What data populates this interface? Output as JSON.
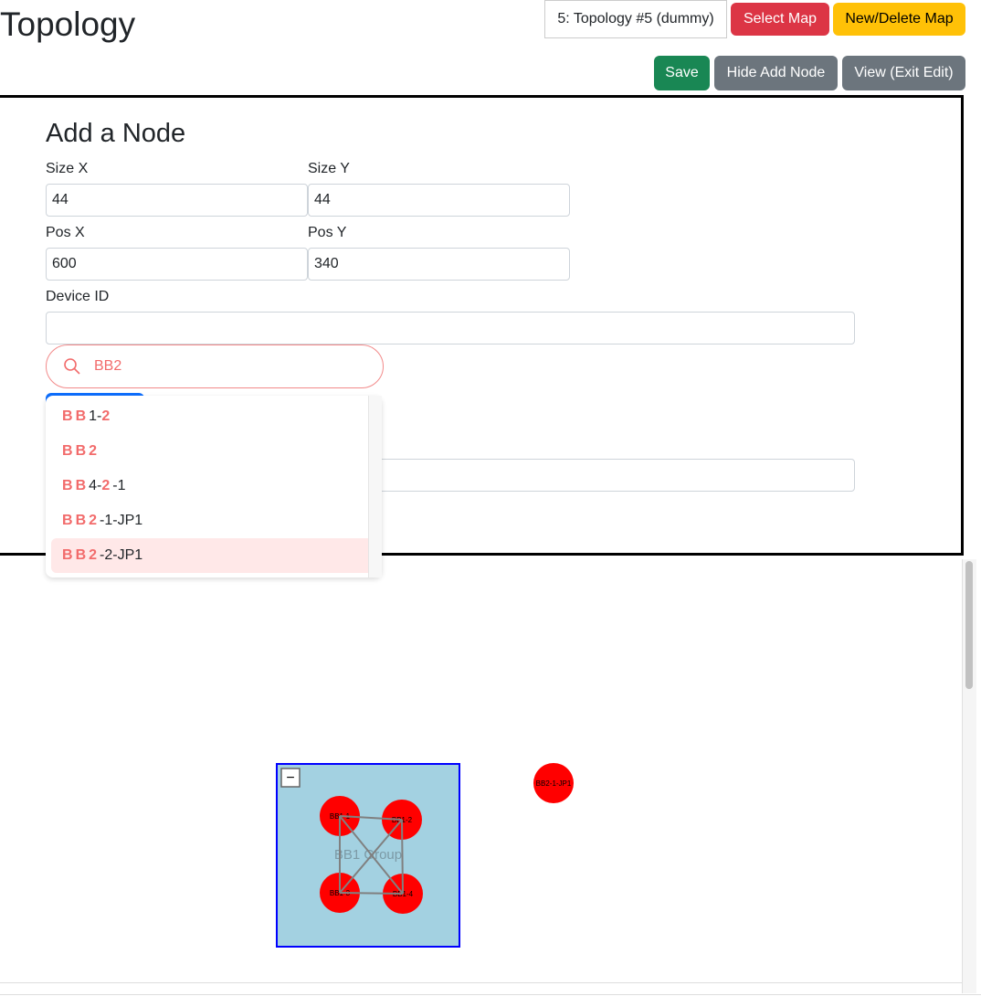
{
  "page_title": "Topology",
  "map_select": "5: Topology #5 (dummy)",
  "buttons": {
    "select_map": "Select Map",
    "new_delete_map": "New/Delete Map",
    "save": "Save",
    "hide_add_node": "Hide Add Node",
    "view_exit_edit": "View (Exit Edit)"
  },
  "colors": {
    "danger": "#dc3545",
    "warning": "#ffc107",
    "success": "#198754",
    "secondary": "#6c757d",
    "highlight": "#f26b6b"
  },
  "add_node": {
    "heading": "Add a Node",
    "size_x_label": "Size X",
    "size_x": "44",
    "size_y_label": "Size Y",
    "size_y": "44",
    "pos_x_label": "Pos X",
    "pos_x": "600",
    "pos_y_label": "Pos Y",
    "pos_y": "340",
    "device_id_label": "Device ID",
    "device_id": "",
    "search_value": "BB2"
  },
  "dropdown": [
    [
      [
        "B",
        1
      ],
      [
        "B",
        1
      ],
      [
        "1-",
        0
      ],
      [
        "2",
        1
      ]
    ],
    [
      [
        "B",
        1
      ],
      [
        "B",
        1
      ],
      [
        "2",
        1
      ]
    ],
    [
      [
        "B",
        1
      ],
      [
        "B",
        1
      ],
      [
        "4-",
        0
      ],
      [
        "2",
        1
      ],
      [
        "-1",
        0
      ]
    ],
    [
      [
        "B",
        1
      ],
      [
        "B",
        1
      ],
      [
        "2",
        1
      ],
      [
        "-1-JP1",
        0
      ]
    ],
    [
      [
        "B",
        1
      ],
      [
        "B",
        1
      ],
      [
        "2",
        1
      ],
      [
        "-2-JP1",
        0
      ]
    ]
  ],
  "topology": {
    "group": {
      "label": "BB1 Group",
      "collapse": "−"
    },
    "nodes": [
      {
        "id": "BB1-1"
      },
      {
        "id": "BB1-2"
      },
      {
        "id": "BB1-3"
      },
      {
        "id": "BB1-4"
      },
      {
        "id": "BB2-1-JP1"
      }
    ],
    "links": [
      [
        "BB1-1",
        "BB1-2"
      ],
      [
        "BB1-1",
        "BB1-3"
      ],
      [
        "BB1-1",
        "BB1-4"
      ],
      [
        "BB1-2",
        "BB1-3"
      ],
      [
        "BB1-2",
        "BB1-4"
      ],
      [
        "BB1-3",
        "BB1-4"
      ]
    ]
  }
}
